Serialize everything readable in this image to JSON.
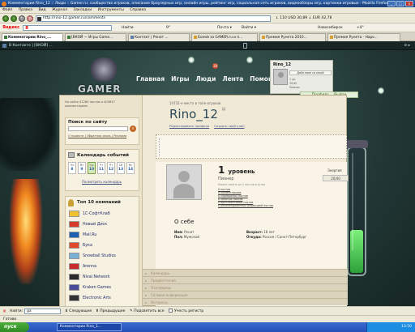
{
  "window": {
    "title": "Комментарии Rino_12 :: Люди :: Gamer.ru: сообщество игроков, описание браузерных игр, онлайн игры, рейтинг игр, социальная сеть игроков, видеообзоры игр, картинки игровые - Mozilla Firefox",
    "buttons": [
      "_",
      "□",
      "×"
    ]
  },
  "menu": [
    "Файл",
    "Правка",
    "Вид",
    "Журнал",
    "Закладки",
    "Инструменты",
    "Справка"
  ],
  "nav": {
    "url": "http://rino-12.gamer.ru/comments",
    "right_info": "↓ 110  USD 30,89  ↓ EUR 42,78"
  },
  "yandex": {
    "logo": "Яндекс",
    "badge": "Я",
    "find_label": "Найти",
    "weather": "9°",
    "items": [
      "Почта ▾",
      "Войти ▾",
      "Новосибирск",
      "+4°"
    ]
  },
  "tabs": [
    {
      "label": "Комментарии Rino_..."
    },
    {
      "label": "[ВКОЙ — Игры Game..."
    },
    {
      "label": "Контакт | Ренат ..."
    },
    {
      "label": "Болей за GAMER.ru и п..."
    },
    {
      "label": "Премия Рунета 2010..."
    },
    {
      "label": "Премия Рунета - Наро..."
    }
  ],
  "vkbar": {
    "text": "В Контакте | [ВКОЙ] ...",
    "right": "≡ ▸"
  },
  "site": {
    "logo": "GAMER",
    "nav": [
      "Главная",
      "Игры",
      "Люди",
      "Лента",
      "Помощь"
    ],
    "bubble": "38"
  },
  "userbox": {
    "name": "Rino_12",
    "action": "Действие со мной",
    "level": "1 ур.",
    "stat1": "20/40",
    "stat2": "Пионер",
    "links": [
      "Профиль",
      "Выйти"
    ]
  },
  "left": {
    "note": "На сайте 47280 постов и 405837 комментариев",
    "search_title": "Поиск по сайту",
    "search_btn": "»",
    "search_links": "О проекте | Обратная связь | Реклама",
    "calendar_title": "Календарь событий",
    "days": [
      {
        "d": "Пн",
        "n": "8"
      },
      {
        "d": "Вт",
        "n": "9"
      },
      {
        "d": "Ср",
        "n": "10"
      },
      {
        "d": "Чт",
        "n": "11"
      },
      {
        "d": "Пт",
        "n": "12"
      },
      {
        "d": "Сб",
        "n": "13"
      },
      {
        "d": "Вс",
        "n": "14"
      }
    ],
    "today_index": 2,
    "calendar_link": "Посмотреть календарь",
    "top_title": "Топ 10 компаний",
    "companies": [
      {
        "name": "1С-СофтКлаб",
        "color": "#f2c12e"
      },
      {
        "name": "Новый Диск",
        "color": "#d63b2a"
      },
      {
        "name": "Mail.Ru",
        "color": "#1d5fb3"
      },
      {
        "name": "Бука",
        "color": "#e04a2a"
      },
      {
        "name": "Snowball Studios",
        "color": "#7ab0d8"
      },
      {
        "name": "Arenna",
        "color": "#c82a2a"
      },
      {
        "name": "Nival Network",
        "color": "#2a2a2a"
      },
      {
        "name": "Kraken Games",
        "color": "#4a4a9a"
      },
      {
        "name": "Electronic Arts",
        "color": "#333333"
      }
    ]
  },
  "profile": {
    "rank": "14732-е место в топе игроков",
    "name": "Rino_12",
    "links": [
      "Редактировать профиль",
      "Создать свой клан"
    ],
    "level_num": "1",
    "level_word": "уровень",
    "level_title": "Пионер",
    "level_hint": "Может писать до 2 постов в сутки",
    "stats": [
      "0 постов",
      "0 комментариев",
      "0 серебряных постов",
      "0 золотых постов",
      "0 бриллиантовых постов",
      "0 рекомендованных редакцией постов"
    ],
    "energy_label": "Энергия",
    "energy_value": "20/40",
    "about_title": "О себе",
    "info_left": [
      [
        "Имя:",
        "Ренат"
      ],
      [
        "Пол:",
        "Мужской"
      ]
    ],
    "info_right": [
      [
        "Возраст:",
        "18 лет"
      ],
      [
        "Откуда:",
        "Россия / Санкт-Петербург"
      ]
    ],
    "accordion": [
      "Календарь",
      "Предпочтения",
      "Платформы",
      "Сетевая информация",
      "Интересы"
    ]
  },
  "tube_fill": 0.35,
  "findbar": {
    "close": "×",
    "label": "Найти:",
    "value": "ga",
    "next": "Следующее",
    "prev": "Предыдущее",
    "highlight": "Подсветить все",
    "case": "Учесть регистр"
  },
  "status": "Готово",
  "taskbar": {
    "start": "пуск",
    "item": "Комментарии Rino_1...",
    "clock": "13:50"
  }
}
